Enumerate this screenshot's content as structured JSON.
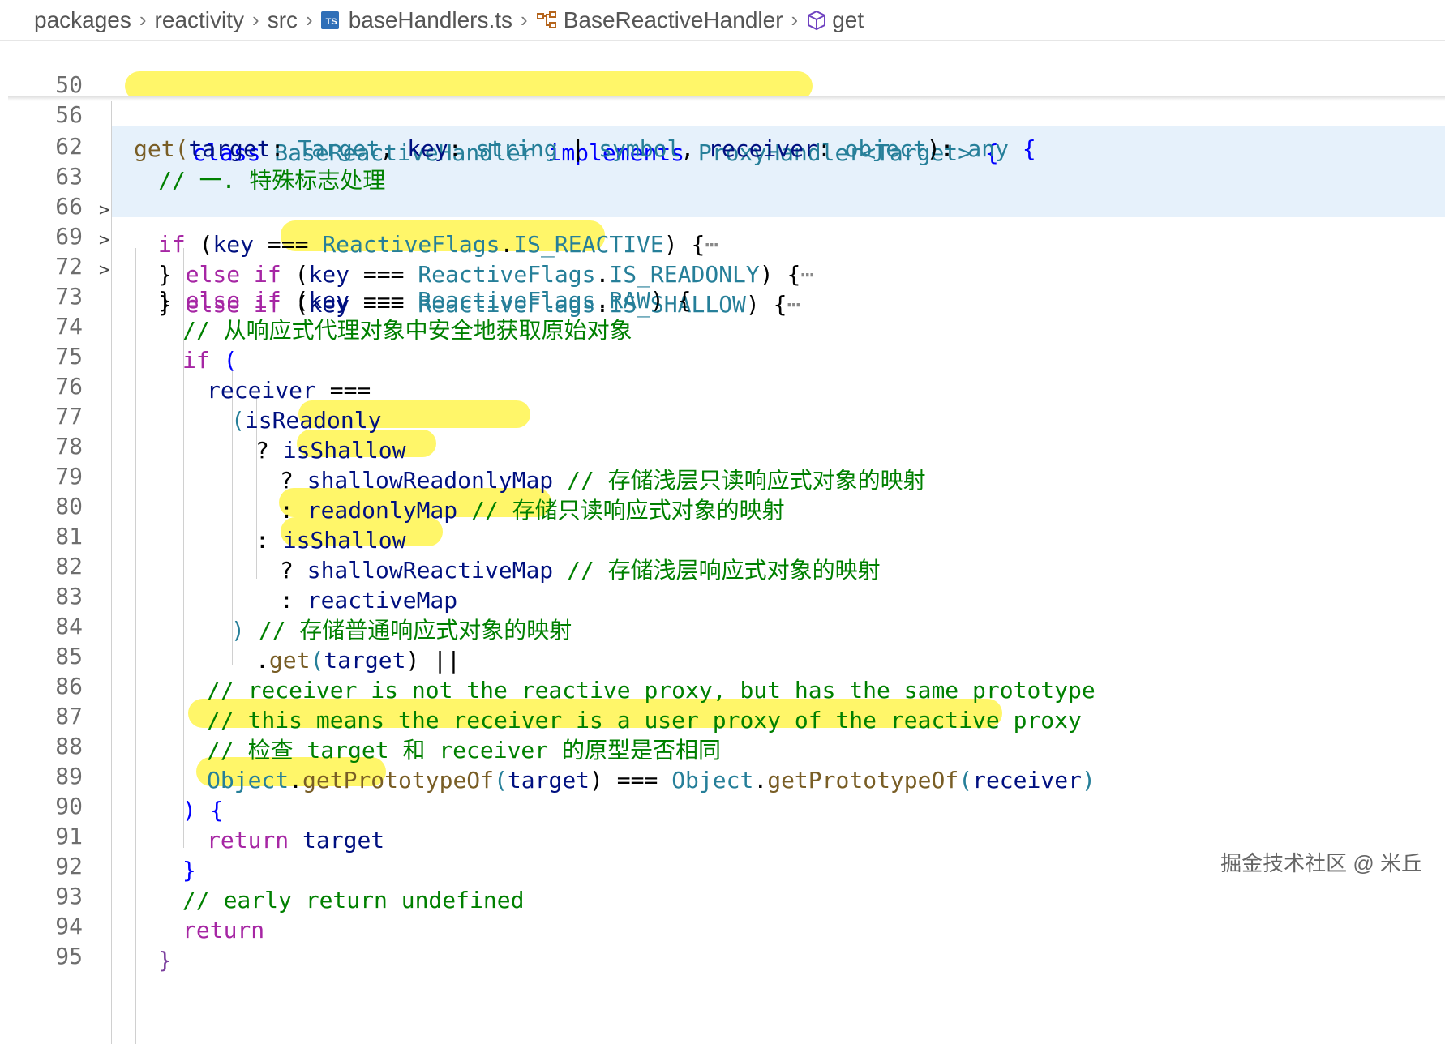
{
  "breadcrumb": {
    "items": [
      "packages",
      "reactivity",
      "src",
      "baseHandlers.ts",
      "BaseReactiveHandler",
      "get"
    ],
    "ts_badge": "TS"
  },
  "lines": [
    {
      "n": "50"
    },
    {
      "n": "56"
    },
    {
      "n": "62"
    },
    {
      "n": "63"
    },
    {
      "n": "66"
    },
    {
      "n": "69"
    },
    {
      "n": "72"
    },
    {
      "n": "73"
    },
    {
      "n": "74"
    },
    {
      "n": "75"
    },
    {
      "n": "76"
    },
    {
      "n": "77"
    },
    {
      "n": "78"
    },
    {
      "n": "79"
    },
    {
      "n": "80"
    },
    {
      "n": "81"
    },
    {
      "n": "82"
    },
    {
      "n": "83"
    },
    {
      "n": "84"
    },
    {
      "n": "85"
    },
    {
      "n": "86"
    },
    {
      "n": "87"
    },
    {
      "n": "88"
    },
    {
      "n": "89"
    },
    {
      "n": "90"
    },
    {
      "n": "91"
    },
    {
      "n": "92"
    },
    {
      "n": "93"
    },
    {
      "n": "94"
    },
    {
      "n": "95"
    }
  ],
  "code": {
    "l50": [
      "class",
      "BaseReactiveHandler",
      "implements",
      "ProxyHandler<Target>",
      "{"
    ],
    "l56": [
      "get(",
      "target",
      ": ",
      "Target",
      ", ",
      "key",
      ": ",
      "string",
      " | ",
      "symbol",
      ", ",
      "receiver",
      ": ",
      "object",
      "): ",
      "any",
      " {"
    ],
    "l62": "// 一. 特殊标志处理",
    "l63": [
      "if",
      " (",
      "key",
      " === ",
      "ReactiveFlags",
      ".",
      "IS_REACTIVE",
      ") {",
      "⋯"
    ],
    "l66": [
      "} ",
      "else if",
      " (",
      "key",
      " === ",
      "ReactiveFlags",
      ".",
      "IS_READONLY",
      ") {",
      "⋯"
    ],
    "l69": [
      "} ",
      "else if",
      " (",
      "key",
      " === ",
      "ReactiveFlags",
      ".",
      "IS_SHALLOW",
      ") {",
      "⋯"
    ],
    "l72": [
      "} ",
      "else if",
      " (",
      "key",
      " === ",
      "ReactiveFlags",
      ".",
      "RAW",
      ") {"
    ],
    "l73": "// 从响应式代理对象中安全地获取原始对象",
    "l74": [
      "if",
      " ("
    ],
    "l75": [
      "receiver",
      " ==="
    ],
    "l76": [
      "(",
      "isReadonly"
    ],
    "l77": [
      "? ",
      "isShallow"
    ],
    "l78": [
      "? ",
      "shallowReadonlyMap",
      " // 存储浅层只读响应式对象的映射"
    ],
    "l79": [
      ": ",
      "readonlyMap",
      " // 存储只读响应式对象的映射"
    ],
    "l80": [
      ": ",
      "isShallow"
    ],
    "l81": [
      "? ",
      "shallowReactiveMap",
      " // 存储浅层响应式对象的映射"
    ],
    "l82": [
      ": ",
      "reactiveMap"
    ],
    "l83": [
      ")",
      " // 存储普通响应式对象的映射"
    ],
    "l84": [
      ".",
      "get",
      "(",
      "target",
      ") ||"
    ],
    "l85": "// receiver is not the reactive proxy, but has the same prototype",
    "l86": "// this means the receiver is a user proxy of the reactive proxy",
    "l87": "// 检查 target 和 receiver 的原型是否相同",
    "l88": [
      "Object",
      ".",
      "getPrototypeOf",
      "(",
      "target",
      ") === ",
      "Object",
      ".",
      "getPrototypeOf",
      "(",
      "receiver",
      ")"
    ],
    "l89": [
      ")",
      " {"
    ],
    "l90": [
      "return",
      " target"
    ],
    "l91": "}",
    "l92": "// early return undefined",
    "l93": "return",
    "l94": "}",
    "l95": ""
  },
  "watermark": "掘金技术社区 @ 米丘",
  "colors": {
    "keyword": "#a626a4",
    "type": "#267f99",
    "identifier": "#001080",
    "comment": "#008000",
    "highlight": "#fff44f",
    "folded_bg": "#e6f1fb"
  }
}
